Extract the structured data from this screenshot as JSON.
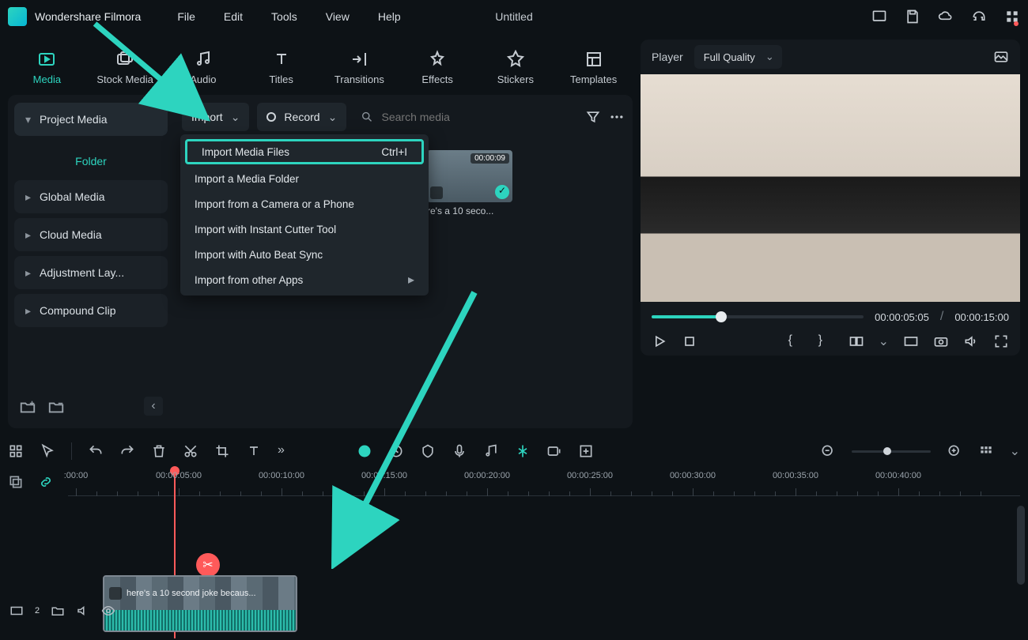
{
  "app_name": "Wondershare Filmora",
  "menu": [
    "File",
    "Edit",
    "Tools",
    "View",
    "Help"
  ],
  "doc_title": "Untitled",
  "cat_tabs": [
    {
      "label": "Media",
      "icon": "media"
    },
    {
      "label": "Stock Media",
      "icon": "stock"
    },
    {
      "label": "Audio",
      "icon": "audio"
    },
    {
      "label": "Titles",
      "icon": "titles"
    },
    {
      "label": "Transitions",
      "icon": "transitions"
    },
    {
      "label": "Effects",
      "icon": "effects"
    },
    {
      "label": "Stickers",
      "icon": "stickers"
    },
    {
      "label": "Templates",
      "icon": "templates"
    }
  ],
  "sidebar": {
    "project": "Project Media",
    "folder": "Folder",
    "items": [
      "Global Media",
      "Cloud Media",
      "Adjustment Lay...",
      "Compound Clip"
    ]
  },
  "toolbar": {
    "import": "Import",
    "record": "Record",
    "search_placeholder": "Search media"
  },
  "import_menu": [
    {
      "label": "Import Media Files",
      "accel": "Ctrl+I",
      "hi": true
    },
    {
      "label": "Import a Media Folder"
    },
    {
      "label": "Import from a Camera or a Phone"
    },
    {
      "label": "Import with Instant Cutter Tool"
    },
    {
      "label": "Import with Auto Beat Sync"
    },
    {
      "label": "Import from other Apps",
      "sub": true
    }
  ],
  "thumb": {
    "duration": "00:00:09",
    "title": "re's a 10 seco..."
  },
  "player": {
    "label": "Player",
    "quality": "Full Quality",
    "current": "00:00:05:05",
    "total": "00:00:15:00",
    "sep": "/"
  },
  "ruler_ticks": [
    ":00:00",
    "00:00:05:00",
    "00:00:10:00",
    "00:00:15:00",
    "00:00:20:00",
    "00:00:25:00",
    "00:00:30:00",
    "00:00:35:00",
    "00:00:40:00"
  ],
  "clip_title": "here's a 10 second joke becaus...",
  "track_badge": "2"
}
